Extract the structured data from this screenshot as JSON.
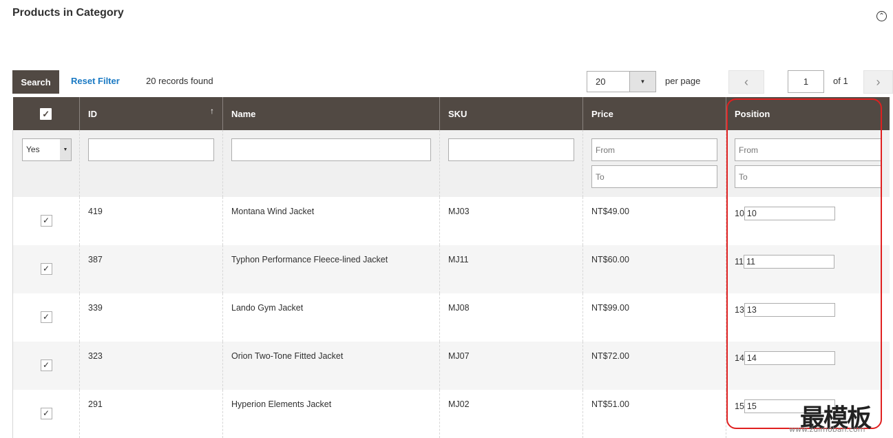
{
  "section": {
    "title": "Products in Category",
    "collapse_icon": "⌃"
  },
  "toolbar": {
    "search_label": "Search",
    "reset_label": "Reset Filter",
    "records_text": "20 records found",
    "per_page_value": "20",
    "per_page_label": "per page",
    "page_value": "1",
    "page_total": "of 1",
    "prev_icon": "‹",
    "next_icon": "›"
  },
  "grid": {
    "headers": {
      "check": "✓",
      "id": "ID",
      "name": "Name",
      "sku": "SKU",
      "price": "Price",
      "position": "Position",
      "sort_icon": "↑"
    },
    "filters": {
      "in_category": "Yes",
      "price_from_placeholder": "From",
      "price_to_placeholder": "To",
      "position_from_placeholder": "From",
      "position_to_placeholder": "To"
    },
    "rows": [
      {
        "id": "419",
        "name": "Montana Wind Jacket",
        "sku": "MJ03",
        "price": "NT$49.00",
        "position_text": "10",
        "position_value": "10"
      },
      {
        "id": "387",
        "name": "Typhon Performance Fleece-lined Jacket",
        "sku": "MJ11",
        "price": "NT$60.00",
        "position_text": "11",
        "position_value": "11"
      },
      {
        "id": "339",
        "name": "Lando Gym Jacket",
        "sku": "MJ08",
        "price": "NT$99.00",
        "position_text": "13",
        "position_value": "13"
      },
      {
        "id": "323",
        "name": "Orion Two-Tone Fitted Jacket",
        "sku": "MJ07",
        "price": "NT$72.00",
        "position_text": "14",
        "position_value": "14"
      },
      {
        "id": "291",
        "name": "Hyperion Elements Jacket",
        "sku": "MJ02",
        "price": "NT$51.00",
        "position_text": "15",
        "position_value": "15"
      }
    ]
  },
  "watermark": {
    "text": "最模板",
    "url": "www.zuimoban.com"
  },
  "colors": {
    "header_bg": "#514943",
    "link": "#1979c3",
    "highlight": "#e02020"
  }
}
